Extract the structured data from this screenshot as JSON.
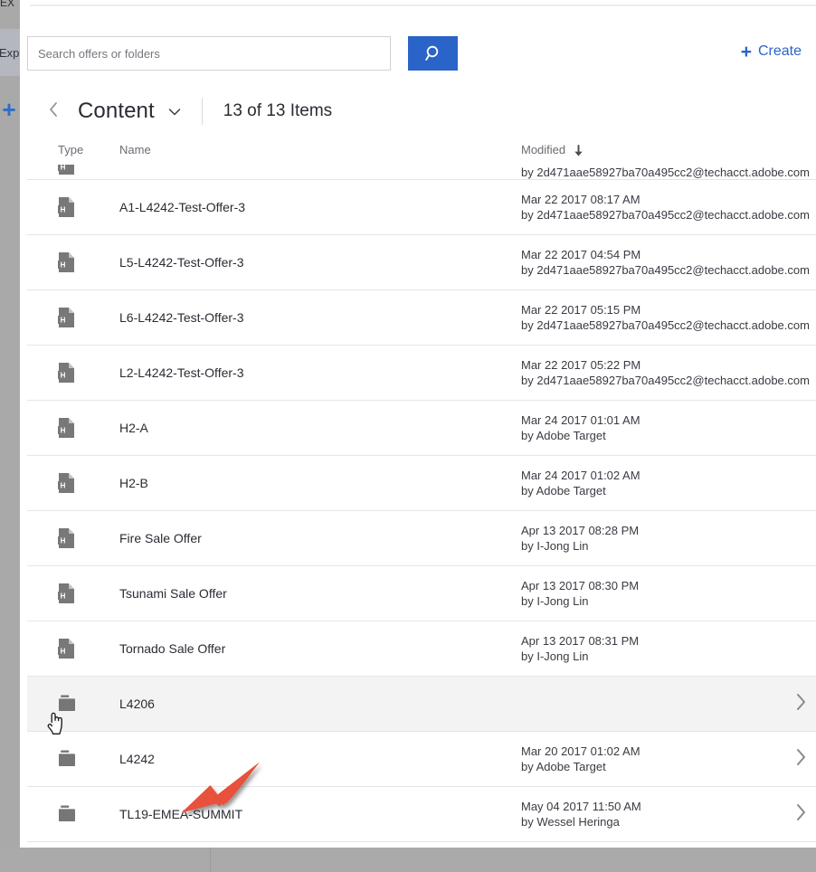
{
  "rail": {
    "label_top": "EX",
    "label_exp": "Exp",
    "plus": "+"
  },
  "search": {
    "placeholder": "Search offers or folders",
    "value": "",
    "button_icon": "search-icon"
  },
  "create": {
    "label": "Create",
    "plus": "+"
  },
  "breadcrumb": {
    "back_icon": "chevron-left-icon",
    "title": "Content",
    "caret_icon": "chevron-down-icon",
    "count": "13 of 13 Items"
  },
  "table": {
    "columns": {
      "type": "Type",
      "name": "Name",
      "modified": "Modified",
      "sort_icon": "arrow-down-icon"
    },
    "rows": [
      {
        "icon": "html-file-icon",
        "name": "",
        "modified_date": "",
        "modified_by": "by 2d471aae58927ba70a495cc2@techacct.adobe.com",
        "clipped": true,
        "selected": false,
        "has_chevron": false
      },
      {
        "icon": "html-file-icon",
        "name": "A1-L4242-Test-Offer-3",
        "modified_date": "Mar 22 2017  08:17 AM",
        "modified_by": "by 2d471aae58927ba70a495cc2@techacct.adobe.com",
        "clipped": false,
        "selected": false,
        "has_chevron": false
      },
      {
        "icon": "html-file-icon",
        "name": "L5-L4242-Test-Offer-3",
        "modified_date": "Mar 22 2017  04:54 PM",
        "modified_by": "by 2d471aae58927ba70a495cc2@techacct.adobe.com",
        "clipped": false,
        "selected": false,
        "has_chevron": false
      },
      {
        "icon": "html-file-icon",
        "name": "L6-L4242-Test-Offer-3",
        "modified_date": "Mar 22 2017  05:15 PM",
        "modified_by": "by 2d471aae58927ba70a495cc2@techacct.adobe.com",
        "clipped": false,
        "selected": false,
        "has_chevron": false
      },
      {
        "icon": "html-file-icon",
        "name": "L2-L4242-Test-Offer-3",
        "modified_date": "Mar 22 2017  05:22 PM",
        "modified_by": "by 2d471aae58927ba70a495cc2@techacct.adobe.com",
        "clipped": false,
        "selected": false,
        "has_chevron": false
      },
      {
        "icon": "html-file-icon",
        "name": "H2-A",
        "modified_date": "Mar 24 2017  01:01 AM",
        "modified_by": "by Adobe Target",
        "clipped": false,
        "selected": false,
        "has_chevron": false
      },
      {
        "icon": "html-file-icon",
        "name": "H2-B",
        "modified_date": "Mar 24 2017  01:02 AM",
        "modified_by": "by Adobe Target",
        "clipped": false,
        "selected": false,
        "has_chevron": false
      },
      {
        "icon": "html-file-icon",
        "name": "Fire Sale Offer",
        "modified_date": "Apr 13 2017  08:28 PM",
        "modified_by": "by I-Jong Lin",
        "clipped": false,
        "selected": false,
        "has_chevron": false
      },
      {
        "icon": "html-file-icon",
        "name": "Tsunami Sale Offer",
        "modified_date": "Apr 13 2017  08:30 PM",
        "modified_by": "by I-Jong Lin",
        "clipped": false,
        "selected": false,
        "has_chevron": false
      },
      {
        "icon": "html-file-icon",
        "name": "Tornado Sale Offer",
        "modified_date": "Apr 13 2017  08:31 PM",
        "modified_by": "by I-Jong Lin",
        "clipped": false,
        "selected": false,
        "has_chevron": false
      },
      {
        "icon": "folder-icon",
        "name": "L4206",
        "modified_date": "",
        "modified_by": "",
        "clipped": false,
        "selected": true,
        "has_chevron": true
      },
      {
        "icon": "folder-icon",
        "name": "L4242",
        "modified_date": "Mar 20 2017  01:02 AM",
        "modified_by": "by Adobe Target",
        "clipped": false,
        "selected": false,
        "has_chevron": true
      },
      {
        "icon": "folder-icon",
        "name": "TL19-EMEA-SUMMIT",
        "modified_date": "May 04 2017  11:50 AM",
        "modified_by": "by Wessel Heringa",
        "clipped": false,
        "selected": false,
        "has_chevron": true
      }
    ]
  },
  "annotation": {
    "arrow_color": "#e8513a",
    "cursor_icon": "pointer-hand-cursor"
  },
  "colors": {
    "accent_blue": "#2a64c8",
    "rail_gray": "#a9a9a9",
    "row_selected": "#f3f3f3",
    "border": "#e6e6e6",
    "text_primary": "#2b2b34",
    "text_secondary": "#6b6b74",
    "icon_gray": "#767676"
  }
}
